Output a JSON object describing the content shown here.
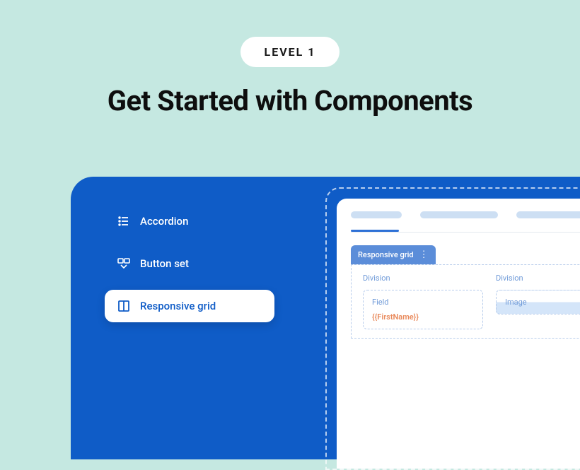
{
  "header": {
    "level_badge": "LEVEL 1",
    "title": "Get Started with Components"
  },
  "sidebar": {
    "items": [
      {
        "label": "Accordion",
        "icon": "list-icon"
      },
      {
        "label": "Button set",
        "icon": "button-set-icon"
      },
      {
        "label": "Responsive grid",
        "icon": "grid-icon"
      }
    ]
  },
  "preview": {
    "grid_tag": "Responsive grid",
    "divisions": [
      {
        "label": "Division",
        "field": {
          "label": "Field",
          "value": "{{FirstName}}"
        }
      },
      {
        "label": "Division",
        "image": {
          "label": "Image"
        }
      }
    ]
  }
}
